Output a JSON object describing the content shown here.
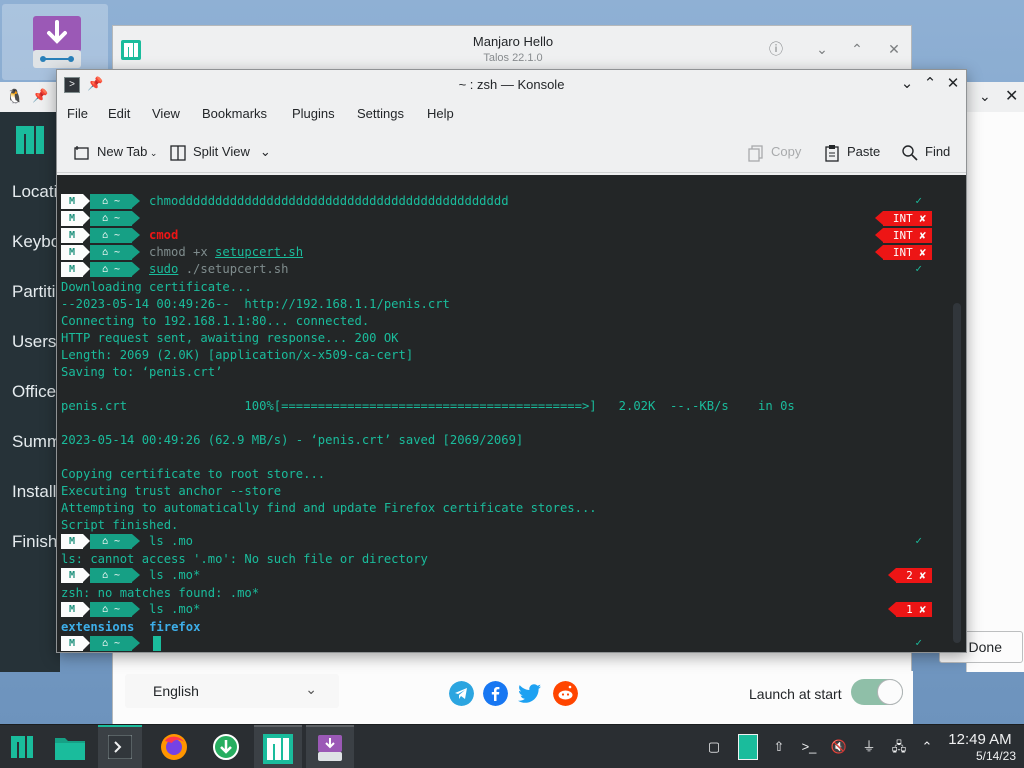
{
  "installer": {
    "items": [
      "Location",
      "Keyboard",
      "Partitions",
      "Users",
      "Office",
      "Summary",
      "Install",
      "Finish"
    ]
  },
  "right_window": {
    "done_label": "Done"
  },
  "hello": {
    "title": "Manjaro Hello",
    "subtitle": "Talos 22.1.0",
    "language": "English",
    "launch_label": "Launch at start",
    "launch_enabled": true
  },
  "konsole": {
    "title": "~ : zsh — Konsole",
    "menu": [
      "File",
      "Edit",
      "View",
      "Bookmarks",
      "Plugins",
      "Settings",
      "Help"
    ],
    "toolbar": {
      "new_tab": "New Tab",
      "split_view": "Split View",
      "copy": "Copy",
      "paste": "Paste",
      "find": "Find"
    }
  },
  "terminal": {
    "prompt_icon": "M",
    "prompt_dir": "⌂ ~",
    "commands": [
      {
        "text": "chmoddddddddddddddddddddddddddddddddddddddddddddd",
        "status": "✓"
      },
      {
        "text": "",
        "status": "INT ✘"
      },
      {
        "text": "cmod",
        "status": "INT ✘"
      },
      {
        "text_cmd": "chmod +x ",
        "text_arg": "setupcert.sh",
        "status": "INT ✘"
      },
      {
        "text_cmd": "sudo",
        "text_arg": " ./setupcert.sh",
        "status": "✓"
      }
    ],
    "output1": [
      "Downloading certificate...",
      "--2023-05-14 00:49:26--  http://192.168.1.1/penis.crt",
      "Connecting to 192.168.1.1:80... connected.",
      "HTTP request sent, awaiting response... 200 OK",
      "Length: 2069 (2.0K) [application/x-x509-ca-cert]",
      "Saving to: ‘penis.crt’",
      "",
      "penis.crt                100%[=========================================>]   2.02K  --.-KB/s    in 0s",
      "",
      "2023-05-14 00:49:26 (62.9 MB/s) - ‘penis.crt’ saved [2069/2069]",
      "",
      "Copying certificate to root store...",
      "Executing trust anchor --store",
      "Attempting to automatically find and update Firefox certificate stores...",
      "Script finished."
    ],
    "cmd_ls1": "ls .mo",
    "cmd_ls1_status": "✓",
    "ls1_out": "ls: cannot access '.mo': No such file or directory",
    "cmd_ls2": "ls .mo*",
    "cmd_ls2_status": "2 ✘",
    "ls2_out": "zsh: no matches found: .mo*",
    "cmd_ls3": "ls .mo*",
    "cmd_ls3_status": "1 ✘",
    "ls3_out_a": "extensions",
    "ls3_out_b": "firefox",
    "final_status": "✓"
  },
  "taskbar": {
    "time": "12:49 AM",
    "date": "5/14/23"
  },
  "colors": {
    "accent": "#1abc9c",
    "terminal_bg": "#232627",
    "error": "#ed1515",
    "taskbar": "#2a2e32"
  }
}
